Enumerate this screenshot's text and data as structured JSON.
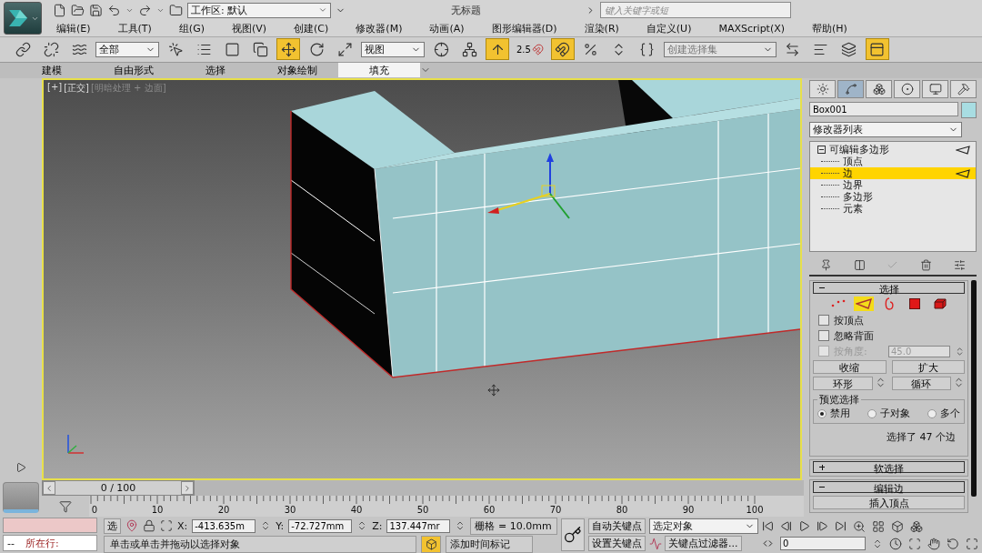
{
  "title_bar": {
    "workspace": "工作区: 默认",
    "title": "无标题",
    "search_placeholder": "键入关键字或短"
  },
  "menu": [
    "编辑(E)",
    "工具(T)",
    "组(G)",
    "视图(V)",
    "创建(C)",
    "修改器(M)",
    "动画(A)",
    "图形编辑器(D)",
    "渲染(R)",
    "自定义(U)",
    "MAXScript(X)",
    "帮助(H)"
  ],
  "toolbar": [
    {
      "kind": "icon",
      "active": false
    },
    {
      "kind": "icon",
      "active": false
    },
    {
      "kind": "icon",
      "active": false
    },
    {
      "kind": "dropdown",
      "value": "全部"
    },
    {
      "kind": "icon",
      "active": false
    },
    {
      "kind": "icon",
      "active": false
    },
    {
      "kind": "icon",
      "active": false
    },
    {
      "kind": "icon",
      "active": false
    },
    {
      "kind": "icon",
      "active": true
    },
    {
      "kind": "icon",
      "active": false
    },
    {
      "kind": "icon",
      "active": false
    },
    {
      "kind": "dropdown",
      "value": "视图"
    },
    {
      "kind": "icon",
      "active": false
    },
    {
      "kind": "icon",
      "active": false
    },
    {
      "kind": "icon",
      "active": true
    },
    {
      "kind": "snap",
      "label": "2.5",
      "active": false
    },
    {
      "kind": "icon",
      "active": true
    },
    {
      "kind": "icon",
      "active": false
    },
    {
      "kind": "icon",
      "active": false
    },
    {
      "kind": "icon",
      "active": false
    },
    {
      "kind": "combo",
      "value": "创建选择集"
    },
    {
      "kind": "icon",
      "active": false
    },
    {
      "kind": "icon",
      "active": false
    },
    {
      "kind": "icon",
      "active": false
    },
    {
      "kind": "icon",
      "active": true
    }
  ],
  "ribbon_tabs": [
    {
      "label": "建模",
      "selected": false
    },
    {
      "label": "自由形式",
      "selected": false
    },
    {
      "label": "选择",
      "selected": false
    },
    {
      "label": "对象绘制",
      "selected": false
    },
    {
      "label": "填充",
      "selected": true
    }
  ],
  "viewport": {
    "labels": [
      "[+]",
      "[正交]",
      "[明暗处理 + 边面]"
    ]
  },
  "command_panel": {
    "tabs": [
      {
        "selected": false
      },
      {
        "selected": true
      },
      {
        "selected": false
      },
      {
        "selected": false
      },
      {
        "selected": false
      },
      {
        "selected": false
      }
    ],
    "object_name": "Box001",
    "modifier_list": "修改器列表",
    "stack": [
      {
        "label": "可编辑多边形",
        "selected": false,
        "expanded": true,
        "children": [
          {
            "label": "顶点",
            "selected": false
          },
          {
            "label": "边",
            "selected": true
          },
          {
            "label": "边界",
            "selected": false
          },
          {
            "label": "多边形",
            "selected": false
          },
          {
            "label": "元素",
            "selected": false
          }
        ]
      }
    ],
    "rollouts": [
      {
        "kind": "selection",
        "title": "选择",
        "expanded": true,
        "modes": [
          {
            "selected": false
          },
          {
            "selected": true
          },
          {
            "selected": false
          },
          {
            "selected": false
          },
          {
            "selected": false
          }
        ],
        "checkboxes": [
          {
            "label": "按顶点",
            "checked": false,
            "disabled": false
          },
          {
            "label": "忽略背面",
            "checked": false,
            "disabled": false
          },
          {
            "label": "按角度:",
            "checked": false,
            "disabled": true,
            "value": "45.0"
          }
        ],
        "buttons": [
          "收缩",
          "扩大"
        ],
        "spinner_buttons": [
          "环形",
          "循环"
        ],
        "preview": {
          "title": "预览选择",
          "options": [
            {
              "label": "禁用",
              "selected": true
            },
            {
              "label": "子对象",
              "selected": false
            },
            {
              "label": "多个",
              "selected": false
            }
          ]
        },
        "status": "选择了 47 个边"
      },
      {
        "kind": "soft",
        "title": "软选择",
        "expanded": false
      },
      {
        "kind": "edit_edges",
        "title": "编辑边",
        "expanded": true,
        "buttons": [
          "插入顶点"
        ]
      }
    ]
  },
  "timeline": {
    "position": "0 / 100",
    "ticks": [
      "0",
      "10",
      "20",
      "30",
      "40",
      "50",
      "60",
      "70",
      "80",
      "90",
      "100"
    ]
  },
  "status_bar": {
    "listener_prompt": "--",
    "listener_label": "所在行:",
    "selection_lock": "选",
    "coordinates": [
      {
        "axis": "X:",
        "value": "-413.635m"
      },
      {
        "axis": "Y:",
        "value": "-72.727mm"
      },
      {
        "axis": "Z:",
        "value": "137.447mr"
      }
    ],
    "grid": "栅格 = 10.0mm",
    "prompt": "单击或单击并拖动以选择对象",
    "viewport_toggle_active": true,
    "time_tag": "添加时间标记",
    "auto_key": "自动关键点",
    "set_key": "设置关键点",
    "key_mode": "选定对象",
    "key_filters": "关键点过滤器...",
    "frame": "0"
  }
}
